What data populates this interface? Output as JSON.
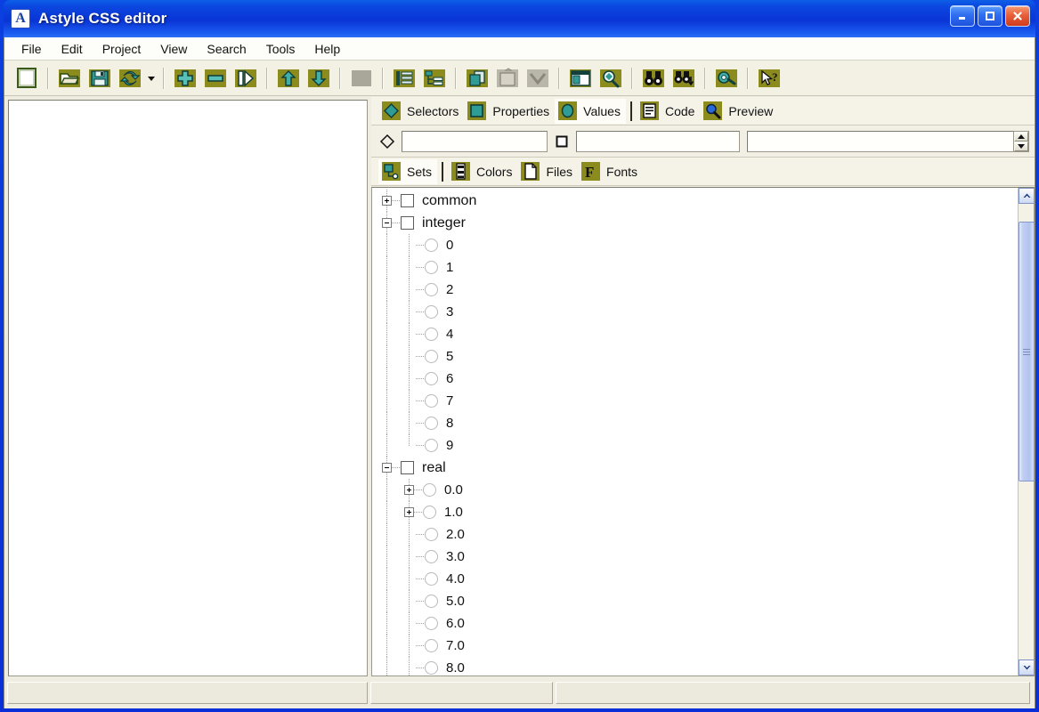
{
  "window": {
    "title": "Astyle CSS editor",
    "icon": "app-a-icon",
    "icon_letter": "A",
    "controls": {
      "minimize": "Minimize",
      "maximize": "Maximize",
      "close": "Close"
    },
    "colors": {
      "titlebar_blue": "#0a34d6",
      "frame_blue": "#0a24d8",
      "client_bg": "#efede1",
      "toolbar_icon_olive": "#8c8c1e",
      "toolbar_icon_teal": "#2f9c96",
      "tree_bg": "#ffffff",
      "scrollbar_blue": "#b2c2ef"
    }
  },
  "menubar": {
    "items": [
      {
        "label": "File"
      },
      {
        "label": "Edit"
      },
      {
        "label": "Project"
      },
      {
        "label": "View"
      },
      {
        "label": "Search"
      },
      {
        "label": "Tools"
      },
      {
        "label": "Help"
      }
    ]
  },
  "toolbar": {
    "buttons": [
      {
        "name": "new-file-button",
        "icon": "new-document-icon",
        "enabled": true
      },
      {
        "name": "open-file-button",
        "icon": "open-folder-icon",
        "enabled": true
      },
      {
        "name": "save-file-button",
        "icon": "floppy-save-icon",
        "enabled": true
      },
      {
        "name": "refresh-button",
        "icon": "refresh-arrows-icon",
        "enabled": true
      },
      {
        "name": "refresh-dropdown-button",
        "icon": "chevron-down-icon",
        "enabled": true
      },
      {
        "name": "add-item-button",
        "icon": "plus-block-icon",
        "enabled": true
      },
      {
        "name": "remove-item-button",
        "icon": "minus-block-icon",
        "enabled": true
      },
      {
        "name": "insert-item-button",
        "icon": "insert-panel-icon",
        "enabled": true
      },
      {
        "name": "move-up-button",
        "icon": "arrow-up-icon",
        "enabled": true
      },
      {
        "name": "move-down-button",
        "icon": "arrow-down-icon",
        "enabled": true
      },
      {
        "name": "stop-button",
        "icon": "stop-square-icon",
        "enabled": false
      },
      {
        "name": "list-view-button",
        "icon": "list-lines-icon",
        "enabled": true
      },
      {
        "name": "tree-view-button",
        "icon": "tree-structure-icon",
        "enabled": true
      },
      {
        "name": "copy-button",
        "icon": "copy-pages-icon",
        "enabled": true
      },
      {
        "name": "paste-button",
        "icon": "paste-icon",
        "enabled": false
      },
      {
        "name": "collapse-button",
        "icon": "chevron-down-box-icon",
        "enabled": false
      },
      {
        "name": "panel-layout-button",
        "icon": "panel-layout-icon",
        "enabled": true
      },
      {
        "name": "preview-zoom-button",
        "icon": "magnifier-diamond-icon",
        "enabled": true
      },
      {
        "name": "find-button",
        "icon": "binoculars-icon",
        "enabled": true
      },
      {
        "name": "find-next-button",
        "icon": "binoculars-down-icon",
        "enabled": true
      },
      {
        "name": "options-button",
        "icon": "wrench-gear-icon",
        "enabled": true
      },
      {
        "name": "help-pointer-button",
        "icon": "pointer-question-icon",
        "enabled": true
      }
    ]
  },
  "main_tabs": {
    "active": "Values",
    "items": [
      {
        "label": "Selectors",
        "icon": "diamond-icon"
      },
      {
        "label": "Properties",
        "icon": "square-block-icon"
      },
      {
        "label": "Values",
        "icon": "oval-icon"
      },
      {
        "label": "Code",
        "icon": "document-lines-icon"
      },
      {
        "label": "Preview",
        "icon": "magnifier-icon"
      }
    ]
  },
  "fields": {
    "selector_icon": "diamond-outline-icon",
    "selector_value": "",
    "selector_placeholder": "",
    "property_icon": "square-outline-icon",
    "property_value": "",
    "property_placeholder": "",
    "value_value": "",
    "value_placeholder": "",
    "spinner_up": "spin-up-icon",
    "spinner_down": "spin-down-icon"
  },
  "sub_tabs": {
    "active": "Sets",
    "items": [
      {
        "label": "Sets",
        "icon": "sets-node-icon"
      },
      {
        "label": "Colors",
        "icon": "color-strip-icon"
      },
      {
        "label": "Files",
        "icon": "page-icon"
      },
      {
        "label": "Fonts",
        "icon": "font-f-icon"
      }
    ]
  },
  "tree": {
    "nodes": [
      {
        "label": "common",
        "level": 0,
        "control": "checkbox",
        "expander": "plus"
      },
      {
        "label": "integer",
        "level": 0,
        "control": "checkbox",
        "expander": "minus"
      },
      {
        "label": "0",
        "level": 1,
        "control": "radio",
        "expander": "none"
      },
      {
        "label": "1",
        "level": 1,
        "control": "radio",
        "expander": "none"
      },
      {
        "label": "2",
        "level": 1,
        "control": "radio",
        "expander": "none"
      },
      {
        "label": "3",
        "level": 1,
        "control": "radio",
        "expander": "none"
      },
      {
        "label": "4",
        "level": 1,
        "control": "radio",
        "expander": "none"
      },
      {
        "label": "5",
        "level": 1,
        "control": "radio",
        "expander": "none"
      },
      {
        "label": "6",
        "level": 1,
        "control": "radio",
        "expander": "none"
      },
      {
        "label": "7",
        "level": 1,
        "control": "radio",
        "expander": "none"
      },
      {
        "label": "8",
        "level": 1,
        "control": "radio",
        "expander": "none"
      },
      {
        "label": "9",
        "level": 1,
        "control": "radio",
        "expander": "none",
        "last": true
      },
      {
        "label": "real",
        "level": 0,
        "control": "checkbox",
        "expander": "minus"
      },
      {
        "label": "0.0",
        "level": 1,
        "control": "radio",
        "expander": "plus"
      },
      {
        "label": "1.0",
        "level": 1,
        "control": "radio",
        "expander": "plus"
      },
      {
        "label": "2.0",
        "level": 1,
        "control": "radio",
        "expander": "none"
      },
      {
        "label": "3.0",
        "level": 1,
        "control": "radio",
        "expander": "none"
      },
      {
        "label": "4.0",
        "level": 1,
        "control": "radio",
        "expander": "none"
      },
      {
        "label": "5.0",
        "level": 1,
        "control": "radio",
        "expander": "none"
      },
      {
        "label": "6.0",
        "level": 1,
        "control": "radio",
        "expander": "none"
      },
      {
        "label": "7.0",
        "level": 1,
        "control": "radio",
        "expander": "none"
      },
      {
        "label": "8.0",
        "level": 1,
        "control": "radio",
        "expander": "none"
      }
    ]
  },
  "scrollbar": {
    "up_icon": "scroll-up-icon",
    "down_icon": "scroll-down-icon",
    "thumb_top_pct": 4,
    "thumb_height_pct": 57
  },
  "statusbar": {
    "panel1": "",
    "panel2": "",
    "panel3": ""
  }
}
